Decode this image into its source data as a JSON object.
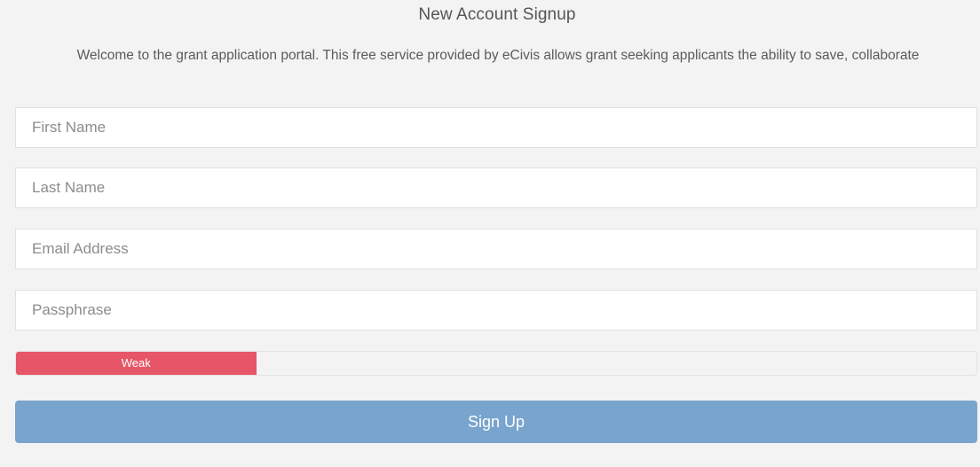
{
  "header": {
    "title": "New Account Signup",
    "intro": "Welcome to the grant application portal. This free service provided by eCivis allows grant seeking applicants the ability to save, collaborate"
  },
  "form": {
    "first_name": {
      "placeholder": "First Name",
      "value": ""
    },
    "last_name": {
      "placeholder": "Last Name",
      "value": ""
    },
    "email": {
      "placeholder": "Email Address",
      "value": ""
    },
    "passphrase": {
      "placeholder": "Passphrase",
      "value": ""
    },
    "strength": {
      "label": "Weak",
      "level_fraction": 0.25,
      "color": "#e65668"
    },
    "submit_label": "Sign Up"
  },
  "colors": {
    "background": "#f3f3f3",
    "primary_button": "#78a4cd",
    "weak": "#e65668"
  }
}
